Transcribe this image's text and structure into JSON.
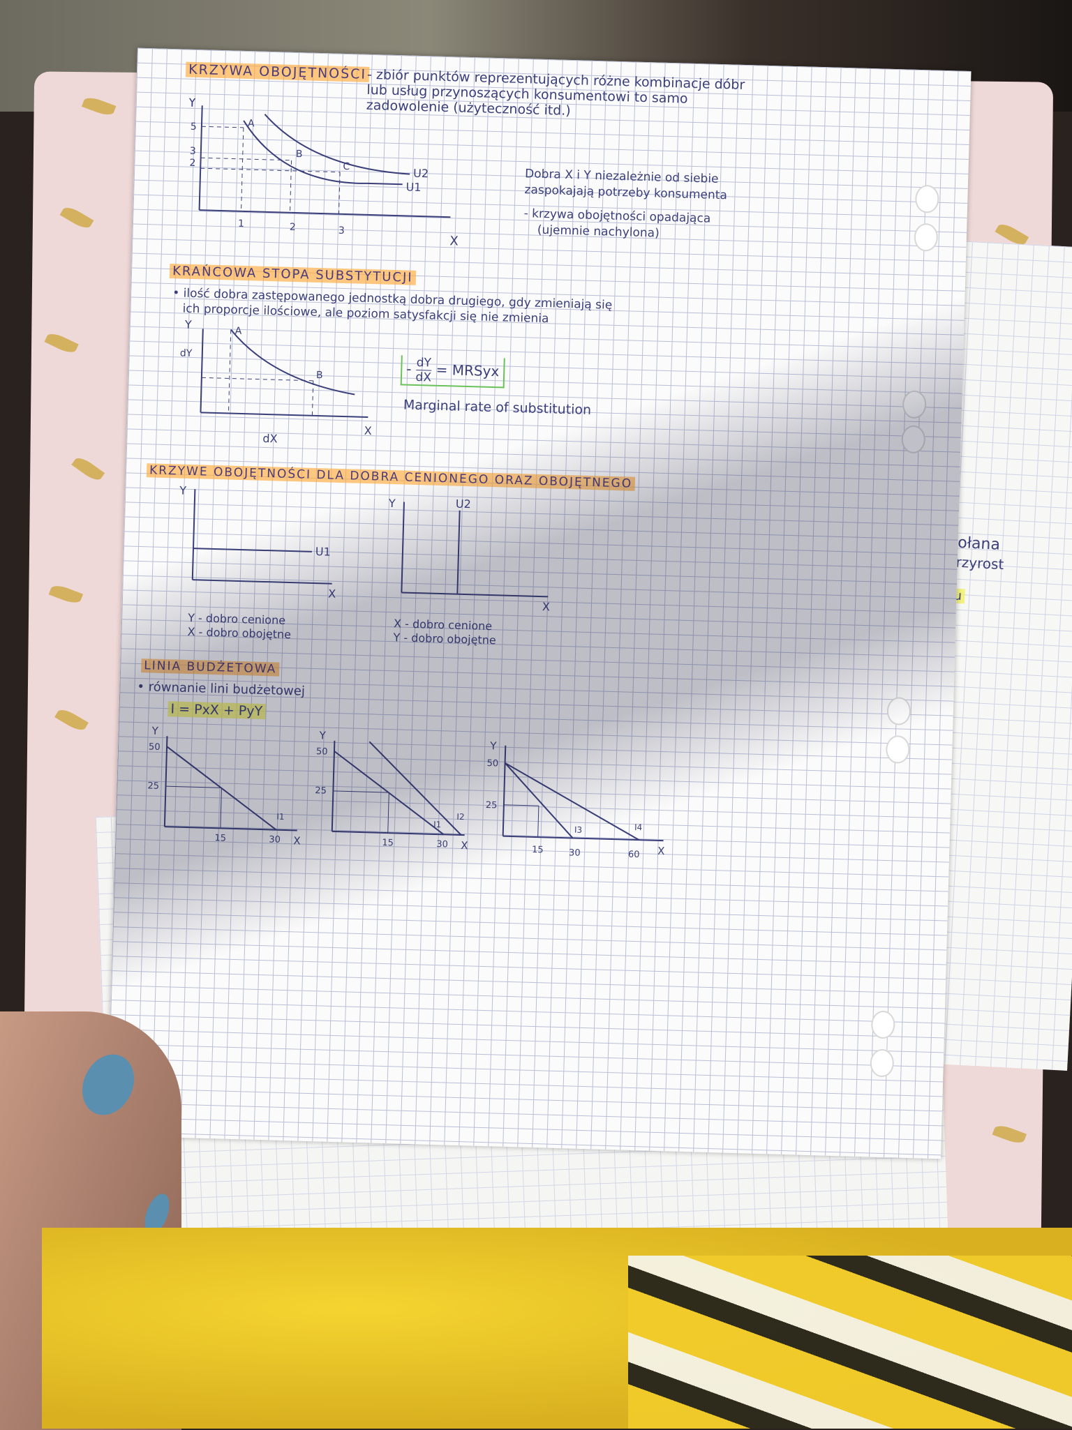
{
  "sections": {
    "s1": {
      "title": "KRZYWA OBOJĘTNOŚCI",
      "definition_lines": [
        "- zbiór punktów reprezentujących różne kombinacje dóbr",
        "lub usług przynoszących konsumentowi to samo",
        "zadowolenie (użyteczność itd.)"
      ],
      "notes": [
        "Dobra X i Y niezależnie od siebie",
        "zaspokajają potrzeby konsumenta",
        "- krzywa obojętności opadająca",
        "(ujemnie nachylona)"
      ],
      "graph": {
        "y_label": "Y",
        "x_label": "X",
        "y_ticks": [
          "5",
          "3",
          "2"
        ],
        "x_ticks": [
          "1",
          "2",
          "3"
        ],
        "points": [
          "A",
          "B",
          "C"
        ],
        "curves": [
          "U2",
          "U1"
        ]
      }
    },
    "s2": {
      "title": "KRAŃCOWA STOPA SUBSTYTUCJI",
      "text_lines": [
        "• ilość dobra zastępowanego jednostką dobra drugiego, gdy zmieniają się",
        "ich proporcje ilościowe, ale poziom satysfakcji się nie zmienia"
      ],
      "formula": "- dY/dX = MRSyx",
      "formula_num": "dY",
      "formula_den": "dX",
      "formula_rhs": "= MRSyx",
      "formula_minus": "-",
      "english": "Marginal rate of substitution",
      "graph": {
        "y_label": "Y",
        "x_label": "X",
        "dy": "dY",
        "dx": "dX",
        "points": [
          "A",
          "B"
        ]
      }
    },
    "s3": {
      "title": "KRZYWE OBOJĘTNOŚCI DLA DOBRA CENIONEGO ORAZ OBOJĘTNEGO",
      "left": {
        "y_label": "Y",
        "x_label": "X",
        "curve": "U1",
        "legend": [
          "Y - dobro cenione",
          "X - dobro obojętne"
        ]
      },
      "right": {
        "y_label": "Y",
        "x_label": "X",
        "curve": "U2",
        "legend": [
          "X - dobro cenione",
          "Y - dobro obojętne"
        ]
      }
    },
    "s4": {
      "title": "LINIA BUDŻETOWA",
      "text": "• równanie lini budżetowej",
      "equation": "I = PxX + PyY",
      "graphs": [
        {
          "y_label": "Y",
          "x_label": "X",
          "y_ticks": [
            "50",
            "25"
          ],
          "x_ticks": [
            "15",
            "30"
          ],
          "lines": [
            "I1"
          ]
        },
        {
          "y_label": "Y",
          "x_label": "X",
          "y_ticks": [
            "50",
            "25"
          ],
          "x_ticks": [
            "15",
            "30"
          ],
          "lines": [
            "I1",
            "I2"
          ]
        },
        {
          "y_label": "Y",
          "x_label": "X",
          "y_ticks": [
            "50",
            "25"
          ],
          "x_ticks": [
            "15",
            "30",
            "60"
          ],
          "lines": [
            "I3",
            "I4"
          ]
        }
      ]
    }
  },
  "side_sheet_fragments": [
    "wołana",
    "przyrost",
    "e",
    "ttu"
  ],
  "colors": {
    "ink": "#3a3f7a",
    "orange_highlight": "#ffaa3c",
    "yellow_highlight": "#f0f05a",
    "green_box": "#6ac25a",
    "pink_folder": "#efd9d8"
  }
}
